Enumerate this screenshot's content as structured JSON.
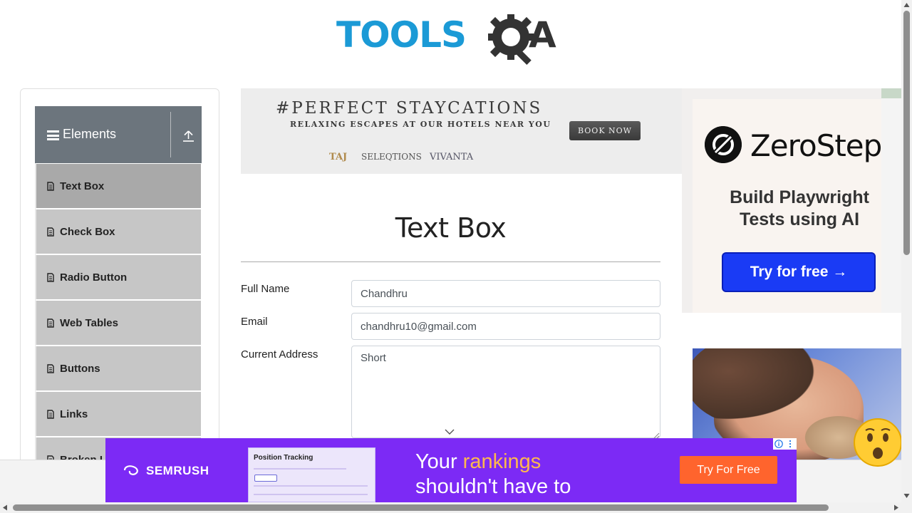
{
  "logo": {
    "tools_text": "TOOLS",
    "a_text": "A"
  },
  "sidebar": {
    "group_title": "Elements",
    "items": [
      {
        "label": "Text Box",
        "active": true
      },
      {
        "label": "Check Box"
      },
      {
        "label": "Radio Button"
      },
      {
        "label": "Web Tables"
      },
      {
        "label": "Buttons"
      },
      {
        "label": "Links"
      },
      {
        "label": "Broken L"
      }
    ]
  },
  "banner_ad": {
    "headline": "#PERFECT STAYCATIONS",
    "subline": "RELAXING ESCAPES AT OUR HOTELS NEAR YOU",
    "cta": "BOOK NOW",
    "brands": [
      "TAJ",
      "SELEQTIONS",
      "VIVANTA"
    ]
  },
  "form": {
    "title": "Text Box",
    "full_name_label": "Full Name",
    "full_name_value": "Chandhru",
    "email_label": "Email",
    "email_value": "chandhru10@gmail.com",
    "address_label": "Current Address",
    "address_value": "Short"
  },
  "right_ad": {
    "brand": "ZeroStep",
    "tagline_1": "Build Playwright",
    "tagline_2": "Tests using AI",
    "cta": "Try for free →"
  },
  "bottom_ad": {
    "brand": "SEMRUSH",
    "screenshot_title": "Position Tracking",
    "copy_1": "Your ",
    "copy_highlight": "rankings",
    "copy_2": "shouldn't have to",
    "cta": "Try For Free"
  },
  "colors": {
    "tools_blue": "#1b9ad6",
    "sidebar_header": "#6c757d",
    "menu_item_bg": "#c6c6c6",
    "menu_item_active": "#a9a9a9",
    "zerostep_button": "#1a3bf5",
    "semrush_purple": "#7c2af5",
    "semrush_cta": "#ff642d"
  },
  "icons": [
    "menu-icon",
    "upload-icon",
    "document-icon",
    "gear-icon",
    "chevron-down-icon",
    "info-icon",
    "close-icon"
  ]
}
